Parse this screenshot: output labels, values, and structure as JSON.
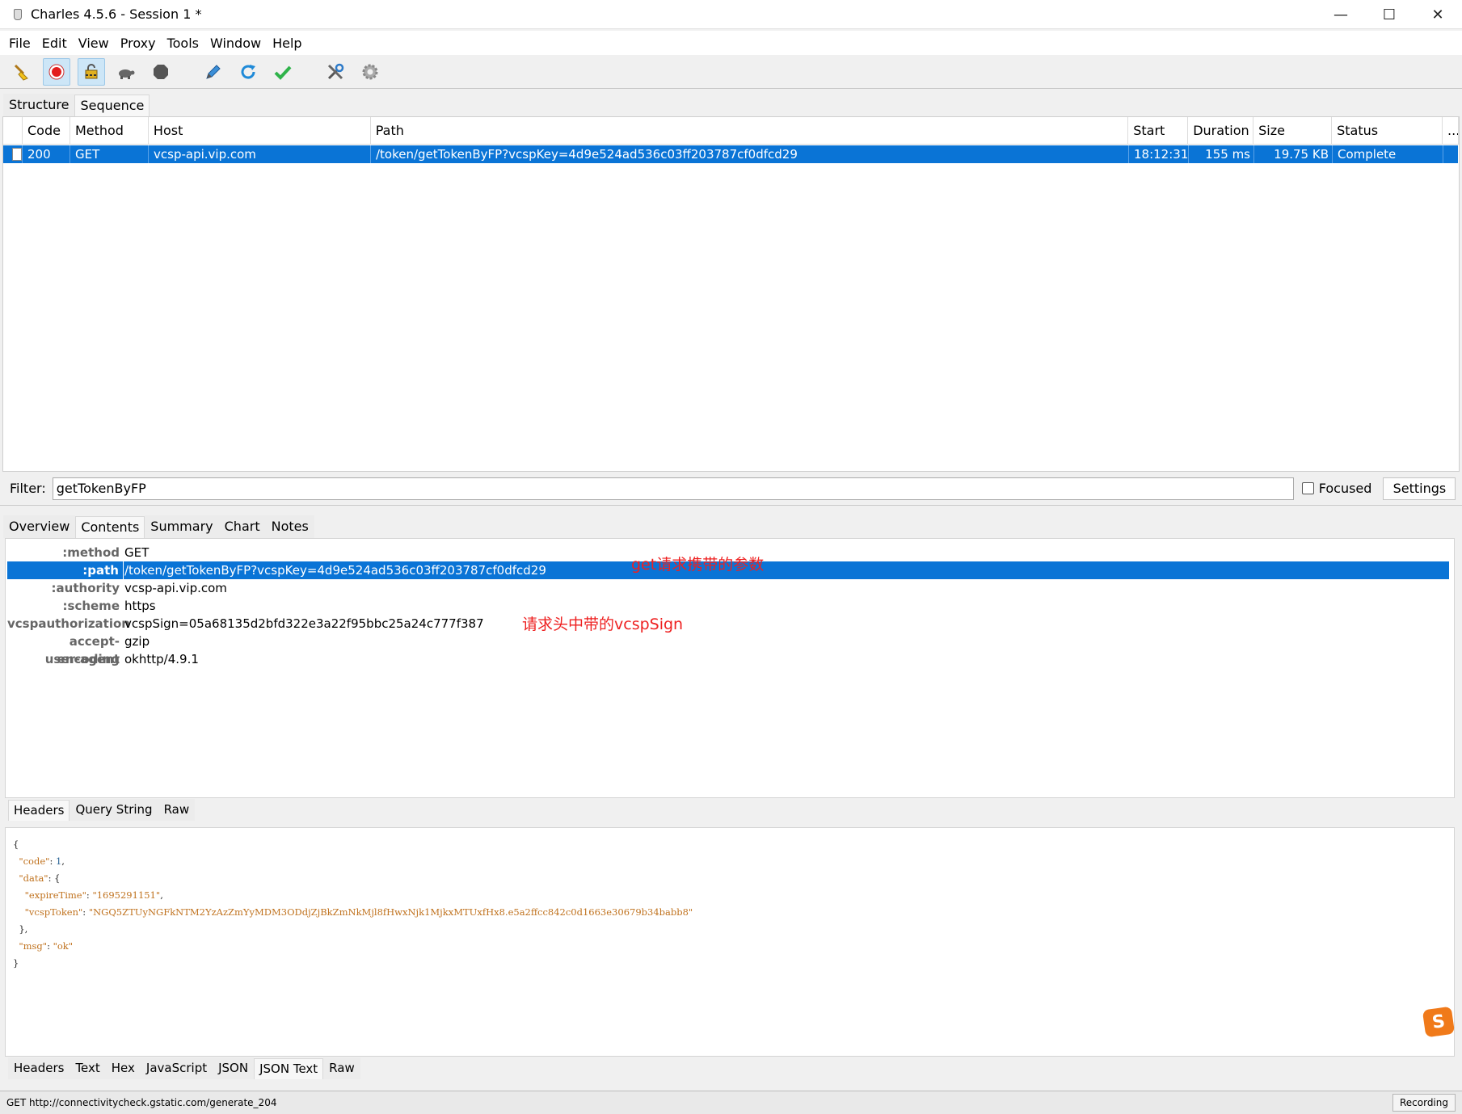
{
  "window": {
    "title": "Charles 4.5.6 - Session 1 *",
    "minimize": "—",
    "maximize": "☐",
    "close": "✕"
  },
  "menu": [
    "File",
    "Edit",
    "View",
    "Proxy",
    "Tools",
    "Window",
    "Help"
  ],
  "toolbar": {
    "icons": [
      "broom-icon",
      "record-icon",
      "ssl-proxy-icon",
      "throttle-icon",
      "breakpoint-icon",
      "compose-icon",
      "repeat-icon",
      "validate-icon",
      "tools-icon",
      "settings-icon"
    ]
  },
  "view_tabs": [
    "Structure",
    "Sequence"
  ],
  "table": {
    "columns": [
      "Code",
      "Method",
      "Host",
      "Path",
      "Start",
      "Duration",
      "Size",
      "Status",
      "..."
    ],
    "rows": [
      {
        "code": "200",
        "method": "GET",
        "host": "vcsp-api.vip.com",
        "path": "/token/getTokenByFP?vcspKey=4d9e524ad536c03ff203787cf0dfcd29",
        "start": "18:12:31",
        "duration": "155 ms",
        "size": "19.75 KB",
        "status": "Complete"
      }
    ]
  },
  "filter": {
    "label": "Filter:",
    "value": "getTokenByFP",
    "focused_label": "Focused",
    "settings_label": "Settings"
  },
  "detail_tabs": [
    "Overview",
    "Contents",
    "Summary",
    "Chart",
    "Notes"
  ],
  "request_headers": [
    {
      "key": ":method",
      "value": "GET"
    },
    {
      "key": ":path",
      "value": "/token/getTokenByFP?vcspKey=4d9e524ad536c03ff203787cf0dfcd29"
    },
    {
      "key": ":authority",
      "value": "vcsp-api.vip.com"
    },
    {
      "key": ":scheme",
      "value": "https"
    },
    {
      "key": "vcspauthorization",
      "value": "vcspSign=05a68135d2bfd322e3a22f95bbc25a24c777f387"
    },
    {
      "key": "accept-encoding",
      "value": "gzip"
    },
    {
      "key": "user-agent",
      "value": "okhttp/4.9.1"
    }
  ],
  "annotations": {
    "get_params": "get请求携带的参数",
    "header_sign": "请求头中带的vcspSign"
  },
  "request_view_tabs": [
    "Headers",
    "Query String",
    "Raw"
  ],
  "response_json": {
    "open": "{",
    "code_key": "\"code\"",
    "code_val": "1",
    "data_key": "\"data\"",
    "data_open": "{",
    "expire_key": "\"expireTime\"",
    "expire_val": "\"1695291151\"",
    "token_key": "\"vcspToken\"",
    "token_val": "\"NGQ5ZTUyNGFkNTM2YzAzZmYyMDM3ODdjZjBkZmNkMjl8fHwxNjk1MjkxMTUxfHx8.e5a2ffcc842c0d1663e30679b34babb8\"",
    "data_close": "},",
    "msg_key": "\"msg\"",
    "msg_val": "\"ok\"",
    "close": "}"
  },
  "response_view_tabs": [
    "Headers",
    "Text",
    "Hex",
    "JavaScript",
    "JSON",
    "JSON Text",
    "Raw"
  ],
  "statusbar": {
    "text": "GET http://connectivitycheck.gstatic.com/generate_204",
    "recording": "Recording"
  },
  "ime": {
    "label": "S"
  }
}
